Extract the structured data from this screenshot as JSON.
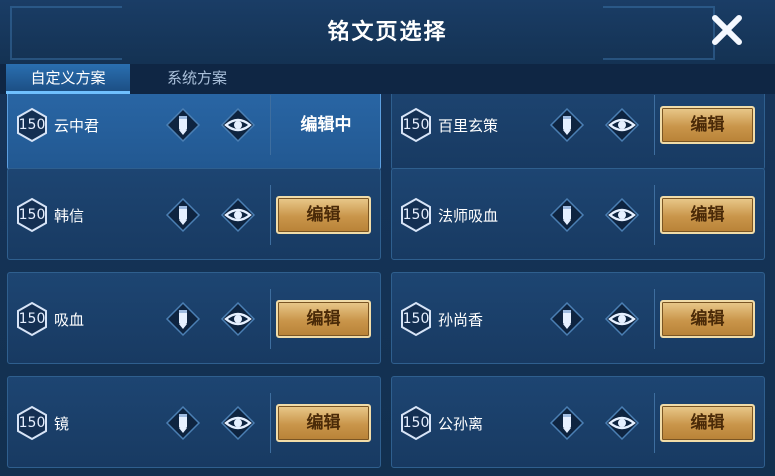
{
  "header": {
    "title": "铭文页选择"
  },
  "tabs": [
    {
      "label": "自定义方案",
      "active": true
    },
    {
      "label": "系统方案",
      "active": false
    }
  ],
  "pages": [
    {
      "level": "150",
      "name": "云中君",
      "status": "编辑中"
    },
    {
      "level": "150",
      "name": "百里玄策",
      "button": "编辑"
    },
    {
      "level": "150",
      "name": "韩信",
      "button": "编辑"
    },
    {
      "level": "150",
      "name": "法师吸血",
      "button": "编辑"
    },
    {
      "level": "150",
      "name": "吸血",
      "button": "编辑"
    },
    {
      "level": "150",
      "name": "孙尚香",
      "button": "编辑"
    },
    {
      "level": "150",
      "name": "镜",
      "button": "编辑"
    },
    {
      "level": "150",
      "name": "公孙离",
      "button": "编辑"
    }
  ],
  "icons": {
    "close": "close-x-icon",
    "rename": "pencil-icon",
    "preview": "eye-icon",
    "level": "hexagon-level-icon"
  },
  "colors": {
    "accent_gold": "#c9954a",
    "selected_card": "#2a68a8",
    "card": "#1d4572"
  }
}
